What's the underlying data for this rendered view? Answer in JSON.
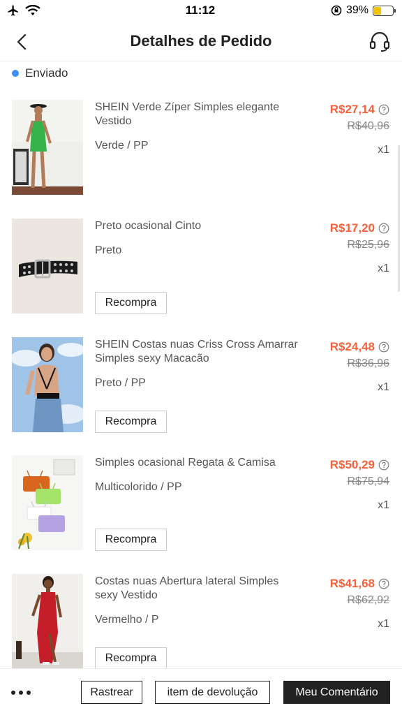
{
  "status_bar": {
    "time": "11:12",
    "battery_percent": "39%",
    "battery_level": 0.39
  },
  "header": {
    "title": "Detalhes de Pedido"
  },
  "order": {
    "status": "Enviado"
  },
  "items": [
    {
      "name": "SHEIN Verde Zíper Simples elegante Vestido",
      "variant": "Verde / PP",
      "price": "R$27,14",
      "original_price": "R$40,96",
      "quantity": "x1"
    },
    {
      "name": "Preto ocasional Cinto",
      "variant": "Preto",
      "price": "R$17,20",
      "original_price": "R$25,96",
      "quantity": "x1",
      "rebuy_label": "Recompra"
    },
    {
      "name": "SHEIN Costas nuas Criss Cross Amarrar Simples sexy Macacão",
      "variant": "Preto / PP",
      "price": "R$24,48",
      "original_price": "R$36,96",
      "quantity": "x1",
      "rebuy_label": "Recompra"
    },
    {
      "name": "Simples ocasional Regata  & Camisa",
      "variant": "Multicolorido / PP",
      "price": "R$50,29",
      "original_price": "R$75,94",
      "quantity": "x1",
      "rebuy_label": "Recompra"
    },
    {
      "name": "Costas nuas Abertura lateral Simples sexy Vestido",
      "variant": "Vermelho / P",
      "price": "R$41,68",
      "original_price": "R$62,92",
      "quantity": "x1",
      "rebuy_label": "Recompra"
    }
  ],
  "actions": {
    "track_label": "Rastrear",
    "return_label": "item de devolução",
    "review_label": "Meu Comentário"
  },
  "colors": {
    "price": "#f5613a",
    "status_dot": "#3d8ff5",
    "primary_button": "#222222"
  },
  "icons": {
    "status_left": [
      "airplane-icon",
      "wifi-icon"
    ],
    "status_right": [
      "orientation-lock-icon",
      "battery-icon"
    ],
    "nav_left": "chevron-left-icon",
    "nav_right": "headset-icon",
    "price_info": "question-circle-icon",
    "more": "more-dots-icon"
  }
}
